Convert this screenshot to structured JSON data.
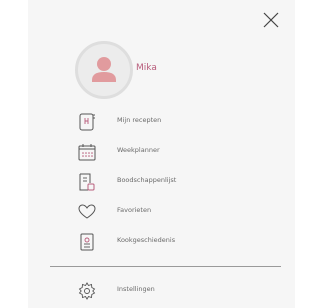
{
  "user": {
    "name": "Mika"
  },
  "menu": {
    "items": [
      {
        "label": "Mijn recepten",
        "icon": "recipe-book-icon"
      },
      {
        "label": "Weekplanner",
        "icon": "calendar-icon"
      },
      {
        "label": "Boodschappenlijst",
        "icon": "shopping-list-icon"
      },
      {
        "label": "Favorieten",
        "icon": "heart-icon"
      },
      {
        "label": "Kookgeschiedenis",
        "icon": "history-icon"
      }
    ]
  },
  "footer": {
    "settings_label": "Instellingen",
    "settings_icon": "gear-icon"
  },
  "colors": {
    "accent": "#b85d7c",
    "icon": "#555555",
    "panel": "#f6f6f6"
  }
}
